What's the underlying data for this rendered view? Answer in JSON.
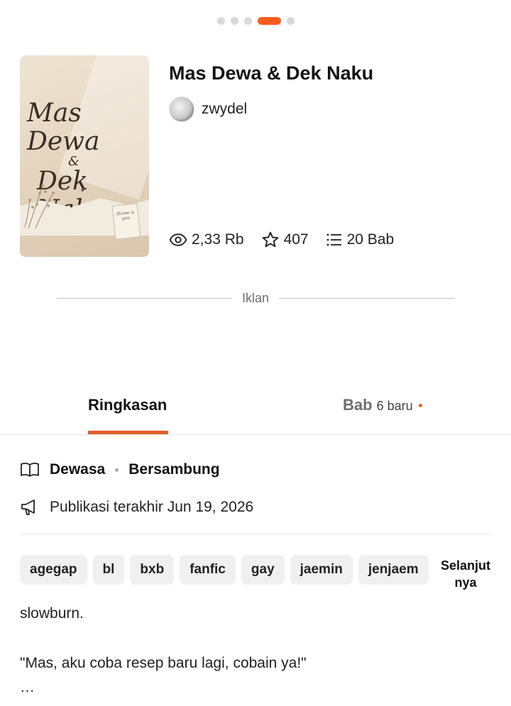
{
  "carousel": {
    "count": 5,
    "active_index": 3
  },
  "book": {
    "title": "Mas Dewa & Dek Naku",
    "author": "zwydel",
    "cover": {
      "script_line1": "Mas Dewa",
      "script_line2": "&",
      "script_line3": "Dek Naku",
      "note": "Home is you"
    },
    "stats": {
      "views": "2,33 Rb",
      "votes": "407",
      "chapters": "20 Bab"
    }
  },
  "ad": {
    "label": "Iklan"
  },
  "tabs": {
    "summary": "Ringkasan",
    "chapters": "Bab",
    "chapters_new": "6 baru"
  },
  "details": {
    "rating": "Dewasa",
    "status": "Bersambung",
    "last_published": "Publikasi terakhir Jun 19, 2026"
  },
  "tags": [
    "agegap",
    "bl",
    "bxb",
    "fanfic",
    "gay",
    "jaemin",
    "jenjaem"
  ],
  "tags_more": "Selanjutnya",
  "description": {
    "line1": "slowburn.",
    "line2": "\"Mas, aku coba resep baru lagi, cobain ya!\"",
    "ellipsis": "…"
  },
  "colors": {
    "accent": "#ff5a1f",
    "underline": "#e0602b"
  }
}
